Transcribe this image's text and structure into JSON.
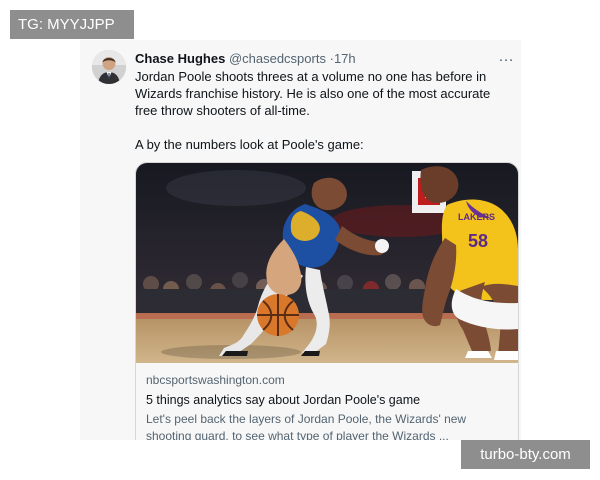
{
  "watermarks": {
    "top_left": "TG: MYYJJPP",
    "bottom_right": "turbo-bty.com"
  },
  "tweet": {
    "author_name": "Chase Hughes",
    "handle": "@chasedcsports",
    "separator": "·",
    "time": "17h",
    "text_line_1": "Jordan Poole shoots threes at a volume no one has before in Wizards franchise history. He is also one of the most accurate free throw shooters of all-time.",
    "text_line_2": "A by the numbers look at Poole's game:",
    "more_icon": "…"
  },
  "link_card": {
    "domain": "nbcsportswashington.com",
    "title": "5 things analytics say about Jordan Poole's game",
    "description": "Let's peel back the layers of Jordan Poole, the Wizards' new shooting guard, to see what type of player the Wizards ..."
  },
  "icons": {
    "more": "more-icon",
    "avatar": "avatar"
  },
  "colors": {
    "card_bg": "#f7f7f7",
    "text": "#0f1419",
    "muted": "#536471",
    "watermark_bg": "#8e8e8e",
    "warriors_blue": "#1d4fa3",
    "lakers_gold": "#f3c21b",
    "court_wood": "#c9ab7d"
  }
}
